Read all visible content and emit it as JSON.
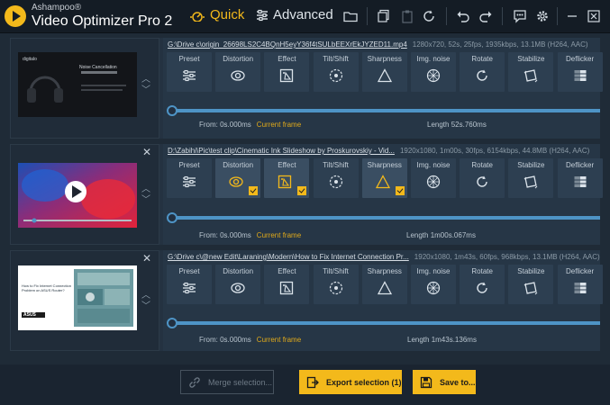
{
  "app": {
    "vendor": "Ashampoo®",
    "name": "Video Optimizer Pro 2",
    "modes": {
      "quick": "Quick",
      "advanced": "Advanced"
    }
  },
  "colors": {
    "accent": "#f3b91b",
    "track": "#4e94c6",
    "current_frame": "#e1aa1a"
  },
  "toolbar_icons": [
    "folder-icon",
    "copy-icon",
    "paste-icon",
    "reset-icon",
    "undo-icon",
    "redo-icon",
    "feedback-icon",
    "settings-icon",
    "close-icon"
  ],
  "videos": [
    {
      "path": "G:\\Drive c\\origin_26698LS2C4BQnH5eyY36f4tSULbEEXrEkJYZED11.mp4",
      "meta": "1280x720, 52s, 25fps, 1935kbps, 13.1MB (H264, AAC)",
      "from": "From: 0s.000ms",
      "current_frame": "Current frame",
      "length": "Length 52s.760ms",
      "close": "",
      "tools": [
        {
          "label": "Preset",
          "icon": "preset-icon",
          "active": false
        },
        {
          "label": "Distortion",
          "icon": "distortion-icon",
          "active": false
        },
        {
          "label": "Effect",
          "icon": "effect-icon",
          "active": false
        },
        {
          "label": "Tilt/Shift",
          "icon": "tilt-shift-icon",
          "active": false
        },
        {
          "label": "Sharpness",
          "icon": "sharpness-icon",
          "active": false
        },
        {
          "label": "Img. noise",
          "icon": "img-noise-icon",
          "active": false
        },
        {
          "label": "Rotate",
          "icon": "rotate-icon",
          "active": false
        },
        {
          "label": "Stabilize",
          "icon": "stabilize-icon",
          "active": false
        },
        {
          "label": "Deflicker",
          "icon": "deflicker-icon",
          "active": false
        }
      ],
      "thumb": {
        "title": "Noise Cancellation",
        "brand": "digitalo"
      }
    },
    {
      "path": "D:\\Zabihi\\Pic\\test clip\\Cinematic     Ink Slideshow by Proskurovskiy - Vid...",
      "meta": "1920x1080, 1m00s, 30fps, 6154kbps, 44.8MB (H264, AAC)",
      "from": "From: 0s.000ms",
      "current_frame": "Current frame",
      "length": "Length 1m00s.067ms",
      "close": "✕",
      "tools": [
        {
          "label": "Preset",
          "icon": "preset-icon",
          "active": false
        },
        {
          "label": "Distortion",
          "icon": "distortion-icon",
          "active": true
        },
        {
          "label": "Effect",
          "icon": "effect-icon",
          "active": true
        },
        {
          "label": "Tilt/Shift",
          "icon": "tilt-shift-icon",
          "active": false
        },
        {
          "label": "Sharpness",
          "icon": "sharpness-icon",
          "active": true
        },
        {
          "label": "Img. noise",
          "icon": "img-noise-icon",
          "active": false
        },
        {
          "label": "Rotate",
          "icon": "rotate-icon",
          "active": false
        },
        {
          "label": "Stabilize",
          "icon": "stabilize-icon",
          "active": false
        },
        {
          "label": "Deflicker",
          "icon": "deflicker-icon",
          "active": false
        }
      ]
    },
    {
      "path": "G:\\Drive c\\@new Edit\\Laraning\\Modern\\How to Fix Internet Connection Pr...",
      "meta": "1920x1080, 1m43s, 60fps, 968kbps, 13.1MB (H264, AAC)",
      "from": "From: 0s.000ms",
      "current_frame": "Current frame",
      "length": "Length 1m43s.136ms",
      "close": "✕",
      "tools": [
        {
          "label": "Preset",
          "icon": "preset-icon",
          "active": false
        },
        {
          "label": "Distortion",
          "icon": "distortion-icon",
          "active": false
        },
        {
          "label": "Effect",
          "icon": "effect-icon",
          "active": false
        },
        {
          "label": "Tilt/Shift",
          "icon": "tilt-shift-icon",
          "active": false
        },
        {
          "label": "Sharpness",
          "icon": "sharpness-icon",
          "active": false
        },
        {
          "label": "Img. noise",
          "icon": "img-noise-icon",
          "active": false
        },
        {
          "label": "Rotate",
          "icon": "rotate-icon",
          "active": false
        },
        {
          "label": "Stabilize",
          "icon": "stabilize-icon",
          "active": false
        },
        {
          "label": "Deflicker",
          "icon": "deflicker-icon",
          "active": false
        }
      ],
      "thumb": {
        "title": "How to Fix Internet Connection Problem on ASUS Router?",
        "brand": "ASUS"
      }
    }
  ],
  "footer": {
    "merge": "Merge selection...",
    "export": "Export selection (1)",
    "save": "Save to..."
  }
}
